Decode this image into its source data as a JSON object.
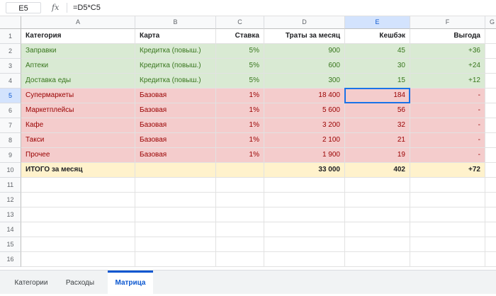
{
  "formula_bar": {
    "cell_ref": "E5",
    "fx_label": "fx",
    "formula": "=D5*C5"
  },
  "columns": [
    {
      "letter": "A",
      "selected": false
    },
    {
      "letter": "B",
      "selected": false
    },
    {
      "letter": "C",
      "selected": false
    },
    {
      "letter": "D",
      "selected": false
    },
    {
      "letter": "E",
      "selected": true
    },
    {
      "letter": "F",
      "selected": false
    },
    {
      "letter": "G",
      "selected": false
    }
  ],
  "rows": [
    {
      "num": "1",
      "style": "header",
      "cells": [
        "Категория",
        "Карта",
        "Ставка",
        "Траты за месяц",
        "Кешбэк",
        "Выгода"
      ]
    },
    {
      "num": "2",
      "style": "green",
      "cells": [
        "Заправки",
        "Кредитка (повыш.)",
        "5%",
        "900",
        "45",
        "+36"
      ]
    },
    {
      "num": "3",
      "style": "green",
      "cells": [
        "Аптеки",
        "Кредитка (повыш.)",
        "5%",
        "600",
        "30",
        "+24"
      ]
    },
    {
      "num": "4",
      "style": "green",
      "cells": [
        "Доставка еды",
        "Кредитка (повыш.)",
        "5%",
        "300",
        "15",
        "+12"
      ]
    },
    {
      "num": "5",
      "style": "red",
      "selected": true,
      "cells": [
        "Супермаркеты",
        "Базовая",
        "1%",
        "18 400",
        "184",
        "-"
      ]
    },
    {
      "num": "6",
      "style": "red",
      "cells": [
        "Маркетплейсы",
        "Базовая",
        "1%",
        "5 600",
        "56",
        "-"
      ]
    },
    {
      "num": "7",
      "style": "red",
      "cells": [
        "Кафе",
        "Базовая",
        "1%",
        "3 200",
        "32",
        "-"
      ]
    },
    {
      "num": "8",
      "style": "red",
      "cells": [
        "Такси",
        "Базовая",
        "1%",
        "2 100",
        "21",
        "-"
      ]
    },
    {
      "num": "9",
      "style": "red",
      "cells": [
        "Прочее",
        "Базовая",
        "1%",
        "1 900",
        "19",
        "-"
      ]
    },
    {
      "num": "10",
      "style": "yellow",
      "cells": [
        "ИТОГО за месяц",
        "",
        "",
        "33 000",
        "402",
        "+72"
      ]
    },
    {
      "num": "11",
      "style": "empty",
      "cells": [
        "",
        "",
        "",
        "",
        "",
        ""
      ]
    },
    {
      "num": "12",
      "style": "empty",
      "cells": [
        "",
        "",
        "",
        "",
        "",
        ""
      ]
    },
    {
      "num": "13",
      "style": "empty",
      "cells": [
        "",
        "",
        "",
        "",
        "",
        ""
      ]
    },
    {
      "num": "14",
      "style": "empty",
      "cells": [
        "",
        "",
        "",
        "",
        "",
        ""
      ]
    },
    {
      "num": "15",
      "style": "empty",
      "cells": [
        "",
        "",
        "",
        "",
        "",
        ""
      ]
    },
    {
      "num": "16",
      "style": "empty",
      "cells": [
        "",
        "",
        "",
        "",
        "",
        ""
      ]
    }
  ],
  "tabs": [
    {
      "label": "Категории",
      "active": false
    },
    {
      "label": "Расходы",
      "active": false
    },
    {
      "label": "Матрица",
      "active": true
    }
  ],
  "colors": {
    "green_fill": "#d9ead3",
    "red_fill": "#f4cccc",
    "yellow_fill": "#fff2cc",
    "selection": "#1a73e8"
  }
}
